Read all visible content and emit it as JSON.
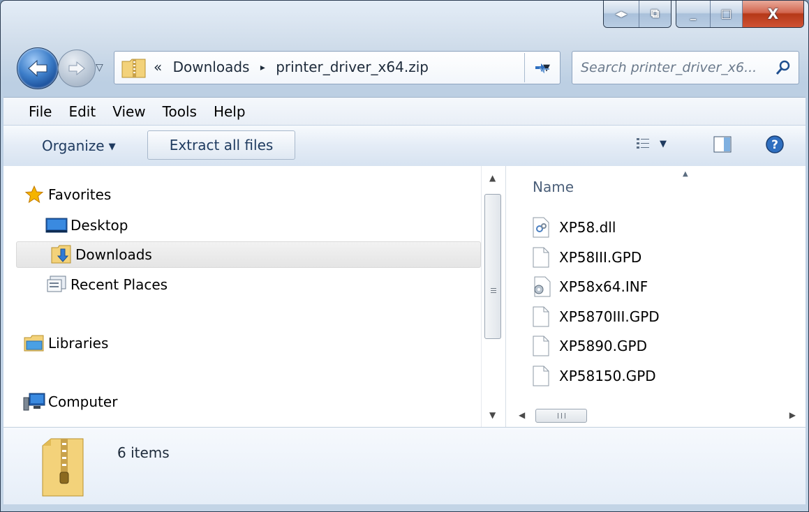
{
  "window": {
    "caption_buttons": {
      "switch_glyph": "◂▸",
      "restore_glyph": "⧉",
      "minimize_glyph": "_",
      "maximize_glyph": "□",
      "close_glyph": "X"
    }
  },
  "address_bar": {
    "prefix": "«",
    "segments": [
      "Downloads",
      "printer_driver_x64.zip"
    ],
    "separator": "▸"
  },
  "search": {
    "placeholder": "Search printer_driver_x6..."
  },
  "menu": [
    "File",
    "Edit",
    "View",
    "Tools",
    "Help"
  ],
  "toolbar": {
    "organize_label": "Organize",
    "extract_label": "Extract all files"
  },
  "navigation": {
    "favorites": {
      "label": "Favorites",
      "icon": "star-icon"
    },
    "favorite_items": [
      {
        "label": "Desktop",
        "icon": "desktop-icon"
      },
      {
        "label": "Downloads",
        "icon": "downloads-folder-icon",
        "selected": true
      },
      {
        "label": "Recent Places",
        "icon": "recent-places-icon"
      }
    ],
    "libraries": {
      "label": "Libraries",
      "icon": "libraries-icon"
    },
    "computer": {
      "label": "Computer",
      "icon": "computer-icon"
    }
  },
  "files": {
    "column_name": "Name",
    "items": [
      {
        "name": "XP58.dll",
        "icon": "dll-file-icon"
      },
      {
        "name": "XP58III.GPD",
        "icon": "blank-file-icon"
      },
      {
        "name": "XP58x64.INF",
        "icon": "inf-file-icon"
      },
      {
        "name": "XP5870III.GPD",
        "icon": "blank-file-icon"
      },
      {
        "name": "XP5890.GPD",
        "icon": "blank-file-icon"
      },
      {
        "name": "XP58150.GPD",
        "icon": "blank-file-icon"
      }
    ]
  },
  "details": {
    "count_text": "6 items"
  },
  "colors": {
    "accent": "#3d7ec9",
    "close_red": "#c4452a",
    "selection_gray": "#e5e5e5",
    "star": "#f5b400"
  }
}
